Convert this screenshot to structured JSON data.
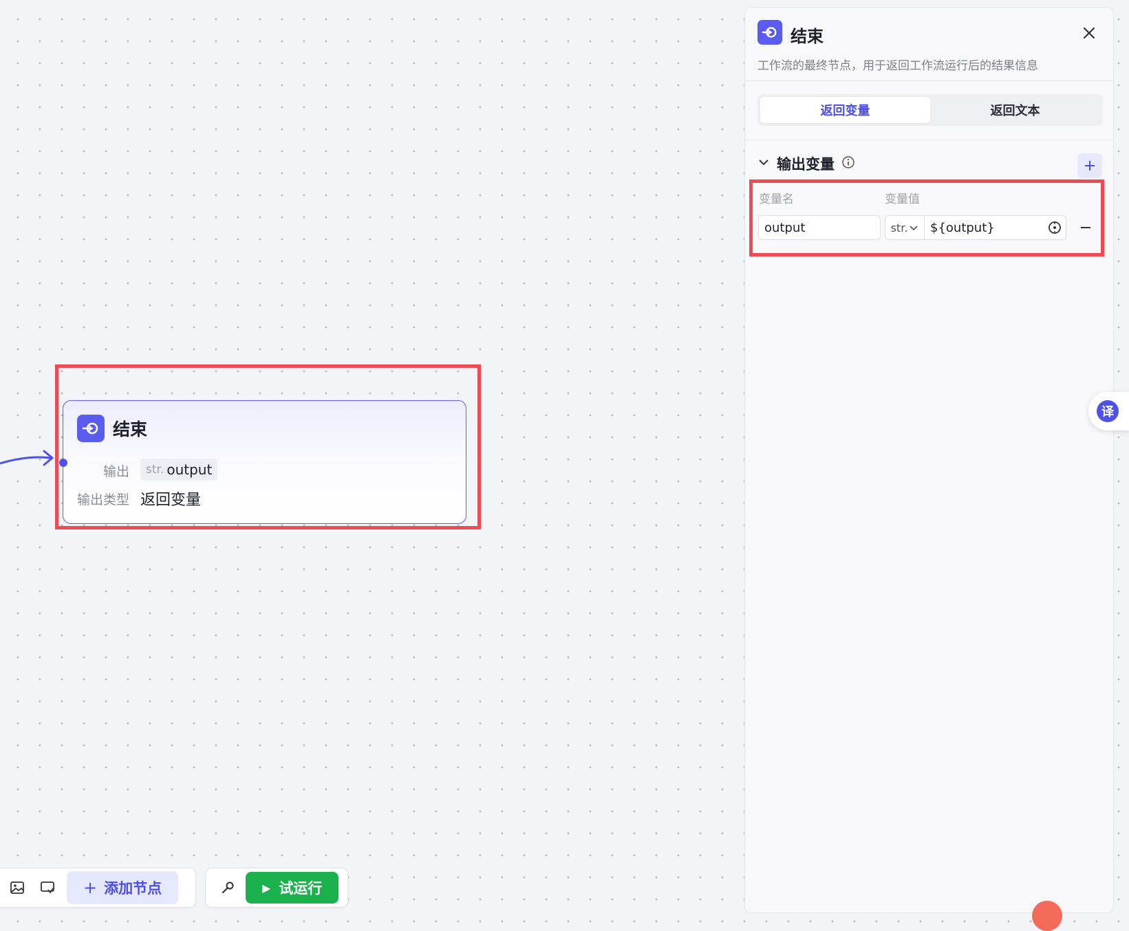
{
  "node": {
    "title": "结束",
    "output_label": "输出",
    "output_type_tag": "str.",
    "output_var": "output",
    "output_type_label": "输出类型",
    "output_type_value": "返回变量"
  },
  "toolbar": {
    "add_node_label": "添加节点",
    "run_label": "试运行"
  },
  "panel": {
    "title": "结束",
    "description": "工作流的最终节点，用于返回工作流运行后的结果信息",
    "tabs": [
      {
        "label": "返回变量",
        "active": true
      },
      {
        "label": "返回文本",
        "active": false
      }
    ],
    "section_title": "输出变量",
    "col_name": "变量名",
    "col_value": "变量值",
    "row": {
      "name": "output",
      "type": "str.",
      "value": "${output}"
    }
  },
  "translate_label": "译",
  "colors": {
    "accent": "#5a5cf0",
    "run_green": "#1bb14d",
    "highlight_red": "#ee4c55"
  },
  "icons": [
    "end-node-icon",
    "close-icon",
    "chevron-down-icon",
    "info-icon",
    "plus-icon",
    "minus-icon",
    "variable-reference-icon",
    "image-icon",
    "comment-icon",
    "wrench-icon",
    "play-icon",
    "translate-icon"
  ]
}
